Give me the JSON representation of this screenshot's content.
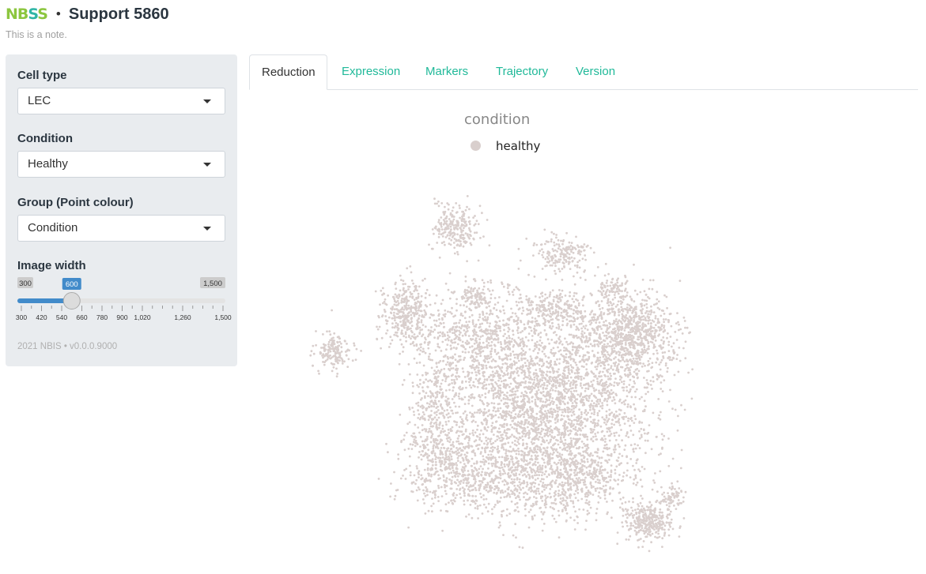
{
  "app": {
    "logo_left": "NB",
    "logo_mid": "S",
    "logo_right": "S",
    "bullet": "•",
    "title": "Support 5860",
    "note": "This is a note."
  },
  "sidebar": {
    "cell_type": {
      "label": "Cell type",
      "value": "LEC"
    },
    "condition": {
      "label": "Condition",
      "value": "Healthy"
    },
    "group": {
      "label": "Group (Point colour)",
      "value": "Condition"
    },
    "image_width": {
      "label": "Image width",
      "min": 300,
      "max": 1500,
      "value": 600,
      "min_label": "300",
      "max_label": "1,500",
      "value_label": "600",
      "ticks": [
        "300",
        "420",
        "540",
        "660",
        "780",
        "900",
        "1,020",
        "1,260",
        "1,500"
      ]
    },
    "footer": "2021 NBIS • v0.0.0.9000"
  },
  "tabs": [
    {
      "label": "Reduction",
      "active": true
    },
    {
      "label": "Expression",
      "active": false
    },
    {
      "label": "Markers",
      "active": false
    },
    {
      "label": "Trajectory",
      "active": false
    },
    {
      "label": "Version",
      "active": false
    }
  ],
  "colors": {
    "accent_green": "#20b999",
    "slider_blue": "#428bca",
    "point_color": "#d9cfcd",
    "sidebar_bg": "#e9ecef"
  },
  "chart_data": {
    "type": "scatter",
    "title": "",
    "legend_title": "condition",
    "series": [
      {
        "name": "healthy",
        "color": "#d9cfcd"
      }
    ],
    "legend_position": "top",
    "grid": false,
    "axes_visible": false
  }
}
